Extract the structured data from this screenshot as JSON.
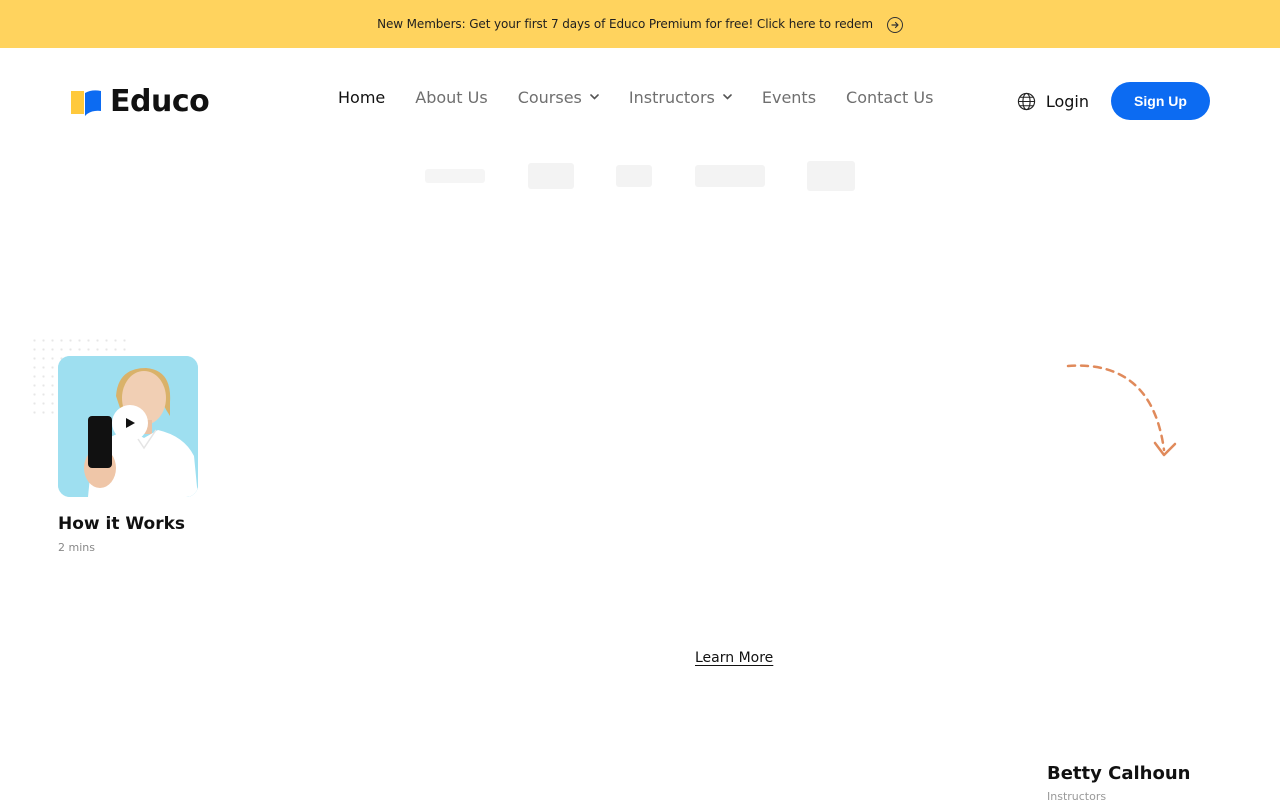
{
  "promo": {
    "text": "New Members: Get your first 7 days of Educo Premium for free! Click here to redem",
    "icon": "arrow-right-circle-icon"
  },
  "header": {
    "logo_text": "Educo",
    "nav": [
      {
        "label": "Home",
        "active": true
      },
      {
        "label": "About Us"
      },
      {
        "label": "Courses",
        "dropdown": true
      },
      {
        "label": "Instructors",
        "dropdown": true
      },
      {
        "label": "Events"
      },
      {
        "label": "Contact Us"
      }
    ],
    "login_label": "Login",
    "signup_label": "Sign Up"
  },
  "video": {
    "title": "How it Works",
    "duration": "2 mins"
  },
  "learn_more": "Learn More",
  "instructor": {
    "name": "Betty Calhoun",
    "role": "Instructors"
  },
  "colors": {
    "promo_bg": "#FFD35E",
    "primary": "#0C6BF2",
    "accent_arrow": "#E08A5B",
    "logo_yellow": "#FFC93C",
    "logo_blue": "#0C6BF2"
  }
}
